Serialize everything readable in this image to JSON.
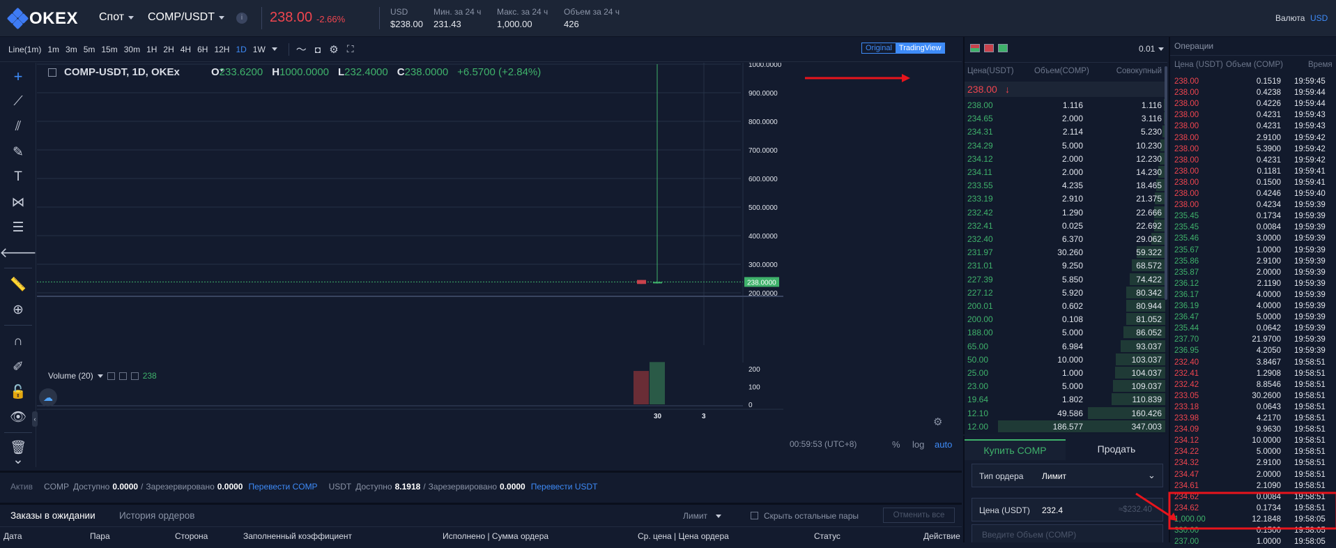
{
  "header": {
    "logo": "OKEX",
    "market_type": "Спот",
    "pair": "COMP/USDT",
    "price": "238.00",
    "change": "-2.66%",
    "stats": [
      {
        "label": "USD",
        "value": "$238.00"
      },
      {
        "label": "Мин. за 24 ч",
        "value": "231.43"
      },
      {
        "label": "Макс. за 24 ч",
        "value": "1,000.00"
      },
      {
        "label": "Объем за 24 ч",
        "value": "426"
      }
    ],
    "currency_label": "Валюта",
    "currency_value": "USD"
  },
  "chart_toolbar": {
    "timeframes": [
      "Line(1m)",
      "1m",
      "3m",
      "5m",
      "15m",
      "30m",
      "1H",
      "2H",
      "4H",
      "6H",
      "12H",
      "1D",
      "1W"
    ],
    "active_timeframe": "1D",
    "view_original": "Original",
    "view_tradingview": "TradingView"
  },
  "legend": {
    "symbol": "COMP-USDT, 1D, OKEx",
    "o_label": "O",
    "o_value": "233.6200",
    "h_label": "H",
    "h_value": "1000.0000",
    "l_label": "L",
    "l_value": "232.4000",
    "c_label": "C",
    "c_value": "238.0000",
    "change": "+6.5700 (+2.84%)",
    "volume_label": "Volume (20)",
    "volume_value": "238"
  },
  "chart_data": {
    "type": "candlestick",
    "y_ticks": [
      "1000.0000",
      "900.0000",
      "800.0000",
      "700.0000",
      "600.0000",
      "500.0000",
      "400.0000",
      "300.0000",
      "200.0000"
    ],
    "last_price_tag": "238.0000",
    "volume_ticks": [
      "200",
      "100",
      "0"
    ],
    "x_ticks": [
      "30",
      "3"
    ],
    "candles": [
      {
        "x": "29",
        "open": 245,
        "high": 245,
        "low": 231,
        "close": 231,
        "color": "#c9424c"
      },
      {
        "x": "30",
        "open": 233.62,
        "high": 1000,
        "low": 232.4,
        "close": 238,
        "color": "#3fb26b"
      }
    ],
    "volumes": [
      {
        "x": "29",
        "value": 188,
        "color": "#6a2d36"
      },
      {
        "x": "30",
        "value": 238,
        "color": "#2a5a47"
      }
    ]
  },
  "chart_footer": {
    "time": "00:59:53 (UTC+8)",
    "percent": "%",
    "log": "log",
    "auto": "auto"
  },
  "orderbook": {
    "step": "0.01",
    "col_price": "Цена(USDT)",
    "col_amount": "Объем(COMP)",
    "col_total": "Совокупный",
    "last_price": "238.00",
    "last_arrow": "↓",
    "rows": [
      {
        "p": "238.00",
        "a": "1.116",
        "c": "1.116",
        "d": 0.003
      },
      {
        "p": "234.65",
        "a": "2.000",
        "c": "3.116",
        "d": 0.009
      },
      {
        "p": "234.31",
        "a": "2.114",
        "c": "5.230",
        "d": 0.015
      },
      {
        "p": "234.29",
        "a": "5.000",
        "c": "10.230",
        "d": 0.029
      },
      {
        "p": "234.12",
        "a": "2.000",
        "c": "12.230",
        "d": 0.035
      },
      {
        "p": "234.11",
        "a": "2.000",
        "c": "14.230",
        "d": 0.041
      },
      {
        "p": "233.55",
        "a": "4.235",
        "c": "18.465",
        "d": 0.053
      },
      {
        "p": "233.19",
        "a": "2.910",
        "c": "21.375",
        "d": 0.062
      },
      {
        "p": "232.42",
        "a": "1.290",
        "c": "22.666",
        "d": 0.065
      },
      {
        "p": "232.41",
        "a": "0.025",
        "c": "22.692",
        "d": 0.065
      },
      {
        "p": "232.40",
        "a": "6.370",
        "c": "29.062",
        "d": 0.084
      },
      {
        "p": "231.97",
        "a": "30.260",
        "c": "59.322",
        "d": 0.171
      },
      {
        "p": "231.01",
        "a": "9.250",
        "c": "68.572",
        "d": 0.198
      },
      {
        "p": "227.39",
        "a": "5.850",
        "c": "74.422",
        "d": 0.214
      },
      {
        "p": "227.12",
        "a": "5.920",
        "c": "80.342",
        "d": 0.232
      },
      {
        "p": "200.01",
        "a": "0.602",
        "c": "80.944",
        "d": 0.233
      },
      {
        "p": "200.00",
        "a": "0.108",
        "c": "81.052",
        "d": 0.234
      },
      {
        "p": "188.00",
        "a": "5.000",
        "c": "86.052",
        "d": 0.248
      },
      {
        "p": "65.00",
        "a": "6.984",
        "c": "93.037",
        "d": 0.268
      },
      {
        "p": "50.00",
        "a": "10.000",
        "c": "103.037",
        "d": 0.297
      },
      {
        "p": "25.00",
        "a": "1.000",
        "c": "104.037",
        "d": 0.3
      },
      {
        "p": "23.00",
        "a": "5.000",
        "c": "109.037",
        "d": 0.314
      },
      {
        "p": "19.64",
        "a": "1.802",
        "c": "110.839",
        "d": 0.319
      },
      {
        "p": "12.10",
        "a": "49.586",
        "c": "160.426",
        "d": 0.462
      },
      {
        "p": "12.00",
        "a": "186.577",
        "c": "347.003",
        "d": 1.0
      }
    ]
  },
  "trades": {
    "title": "Операции",
    "col_price": "Цена (USDT)",
    "col_amount": "Объем (COMP)",
    "col_time": "Время",
    "rows": [
      {
        "p": "238.00",
        "a": "0.1519",
        "t": "19:59:45",
        "s": "sell"
      },
      {
        "p": "238.00",
        "a": "0.4238",
        "t": "19:59:44",
        "s": "sell"
      },
      {
        "p": "238.00",
        "a": "0.4226",
        "t": "19:59:44",
        "s": "sell"
      },
      {
        "p": "238.00",
        "a": "0.4231",
        "t": "19:59:43",
        "s": "sell"
      },
      {
        "p": "238.00",
        "a": "0.4231",
        "t": "19:59:43",
        "s": "sell"
      },
      {
        "p": "238.00",
        "a": "2.9100",
        "t": "19:59:42",
        "s": "sell"
      },
      {
        "p": "238.00",
        "a": "5.3900",
        "t": "19:59:42",
        "s": "sell"
      },
      {
        "p": "238.00",
        "a": "0.4231",
        "t": "19:59:42",
        "s": "sell"
      },
      {
        "p": "238.00",
        "a": "0.1181",
        "t": "19:59:41",
        "s": "sell"
      },
      {
        "p": "238.00",
        "a": "0.1500",
        "t": "19:59:41",
        "s": "sell"
      },
      {
        "p": "238.00",
        "a": "0.4246",
        "t": "19:59:40",
        "s": "sell"
      },
      {
        "p": "238.00",
        "a": "0.4234",
        "t": "19:59:39",
        "s": "sell"
      },
      {
        "p": "235.45",
        "a": "0.1734",
        "t": "19:59:39",
        "s": "buy"
      },
      {
        "p": "235.45",
        "a": "0.0084",
        "t": "19:59:39",
        "s": "buy"
      },
      {
        "p": "235.46",
        "a": "3.0000",
        "t": "19:59:39",
        "s": "buy"
      },
      {
        "p": "235.67",
        "a": "1.0000",
        "t": "19:59:39",
        "s": "buy"
      },
      {
        "p": "235.86",
        "a": "2.9100",
        "t": "19:59:39",
        "s": "buy"
      },
      {
        "p": "235.87",
        "a": "2.0000",
        "t": "19:59:39",
        "s": "buy"
      },
      {
        "p": "236.12",
        "a": "2.1190",
        "t": "19:59:39",
        "s": "buy"
      },
      {
        "p": "236.17",
        "a": "4.0000",
        "t": "19:59:39",
        "s": "buy"
      },
      {
        "p": "236.19",
        "a": "4.0000",
        "t": "19:59:39",
        "s": "buy"
      },
      {
        "p": "236.47",
        "a": "5.0000",
        "t": "19:59:39",
        "s": "buy"
      },
      {
        "p": "235.44",
        "a": "0.0642",
        "t": "19:59:39",
        "s": "buy"
      },
      {
        "p": "237.70",
        "a": "21.9700",
        "t": "19:59:39",
        "s": "buy"
      },
      {
        "p": "236.95",
        "a": "4.2050",
        "t": "19:59:39",
        "s": "buy"
      },
      {
        "p": "232.40",
        "a": "3.8467",
        "t": "19:58:51",
        "s": "sell"
      },
      {
        "p": "232.41",
        "a": "1.2908",
        "t": "19:58:51",
        "s": "sell"
      },
      {
        "p": "232.42",
        "a": "8.8546",
        "t": "19:58:51",
        "s": "sell"
      },
      {
        "p": "233.05",
        "a": "30.2600",
        "t": "19:58:51",
        "s": "sell"
      },
      {
        "p": "233.18",
        "a": "0.0643",
        "t": "19:58:51",
        "s": "sell"
      },
      {
        "p": "233.98",
        "a": "4.2170",
        "t": "19:58:51",
        "s": "sell"
      },
      {
        "p": "234.09",
        "a": "9.9630",
        "t": "19:58:51",
        "s": "sell"
      },
      {
        "p": "234.12",
        "a": "10.0000",
        "t": "19:58:51",
        "s": "sell"
      },
      {
        "p": "234.22",
        "a": "5.0000",
        "t": "19:58:51",
        "s": "sell"
      },
      {
        "p": "234.32",
        "a": "2.9100",
        "t": "19:58:51",
        "s": "sell"
      },
      {
        "p": "234.47",
        "a": "2.0000",
        "t": "19:58:51",
        "s": "sell"
      },
      {
        "p": "234.61",
        "a": "2.1090",
        "t": "19:58:51",
        "s": "sell"
      },
      {
        "p": "234.62",
        "a": "0.0084",
        "t": "19:58:51",
        "s": "sell"
      },
      {
        "p": "234.62",
        "a": "0.1734",
        "t": "19:58:51",
        "s": "sell"
      },
      {
        "p": "1,000.00",
        "a": "12.1848",
        "t": "19:58:05",
        "s": "buy"
      },
      {
        "p": "330.00",
        "a": "0.1500",
        "t": "19:58:05",
        "s": "buy"
      },
      {
        "p": "237.00",
        "a": "1.0000",
        "t": "19:58:05",
        "s": "buy"
      }
    ]
  },
  "assets": {
    "title": "Актив",
    "comp_label": "COMP",
    "available_label": "Доступно",
    "comp_available": "0.0000",
    "reserved_label": "Зарезервировано",
    "comp_reserved": "0.0000",
    "transfer_comp": "Перевести COMP",
    "usdt_label": "USDT",
    "usdt_available": "8.1918",
    "usdt_reserved": "0.0000",
    "transfer_usdt": "Перевести USDT"
  },
  "orders": {
    "tab_pending": "Заказы в ожидании",
    "tab_history": "История ордеров",
    "filter": "Лимит",
    "hide_pairs": "Скрыть остальные пары",
    "cancel_all": "Отменить все",
    "columns": [
      "Дата",
      "Пара",
      "Сторона",
      "Заполненный коэффициент",
      "Исполнено | Сумма ордера",
      "Ср. цена | Цена ордера",
      "Статус",
      "Действие"
    ]
  },
  "trade_form": {
    "tab_buy": "Купить COMP",
    "tab_sell": "Продать",
    "order_type_label": "Тип ордера",
    "order_type_value": "Лимит",
    "price_label": "Цена (USDT)",
    "price_value": "232.4",
    "price_usd": "≈$232.40",
    "amount_placeholder": "Введите Объем (COMP)"
  },
  "colors": {
    "bg": "#131b2e",
    "up": "#3fb26b",
    "down": "#f0454f",
    "accent": "#3e8bf8",
    "annotation": "#e8141c"
  }
}
